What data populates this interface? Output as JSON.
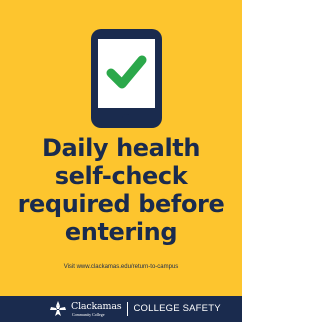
{
  "colors": {
    "background": "#FDC52E",
    "headline": "#1A2B4E",
    "phone": "#1A2B4E",
    "screen": "#FFFFFF",
    "check": "#2BA84A",
    "footer": "#1A2B4E",
    "footer_text": "#FFFFFF"
  },
  "icon": "phone-checkmark-icon",
  "headline": {
    "line1": "Daily health",
    "line2": "self-check",
    "line3": "required before",
    "line4": "entering"
  },
  "visit_text": "Visit www.clackamas.edu/return-to-campus",
  "footer": {
    "logo_name": "Clackamas",
    "logo_sub": "Community College",
    "label": "COLLEGE SAFETY"
  }
}
